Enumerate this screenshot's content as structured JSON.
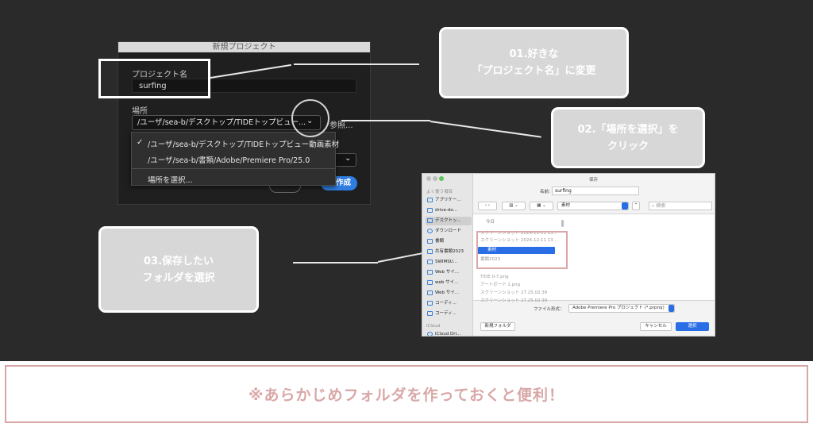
{
  "premiere_dialog": {
    "title": "新規プロジェクト",
    "project_name_label": "プロジェクト名",
    "project_name_value": "surfing",
    "location_label": "場所",
    "location_value": "/ユーザ/sea-b/デスクトップ/TIDEトップビュー...",
    "browse_label": "参照...",
    "menu_items": [
      "/ユーザ/sea-b/デスクトップ/TIDEトップビュー動画素材",
      "/ユーザ/sea-b/書類/Adobe/Premiere Pro/25.0",
      "場所を選択..."
    ],
    "checkmark": "✓",
    "create_label": "作成"
  },
  "callouts": {
    "step1": {
      "line1": "01.好きな",
      "line2": "「プロジェクト名」に変更"
    },
    "step2": {
      "line1": "02.「場所を選択」を",
      "line2": "クリック"
    },
    "step3": {
      "line1": "03.保存したい",
      "line2": "フォルダを選択"
    }
  },
  "save_dialog": {
    "title": "保存",
    "name_label": "名前:",
    "name_value": "surfing",
    "sidebar_heading": "よく使う項目",
    "sidebar_items": [
      "アプリケー...",
      "drive-do...",
      "デスクトッ...",
      "ダウンロード",
      "書類",
      "共有書類2023",
      "SWIMSU...",
      "Web サイ...",
      "web サイ...",
      "Web サイ...",
      "コーディ...",
      "コーディ..."
    ],
    "icloud_heading": "iCloud",
    "icloud_items": [
      "iCloud Dri..."
    ],
    "folder_selector": "素材",
    "search_placeholder": "検索",
    "list_heading": "今日",
    "list_items": [
      "スクリーンショット 2024-12-11 13...",
      "スクリーンショット 2024-12-11 13...",
      "素材",
      "書類2023",
      "TIDE 0-7.png",
      "アートボード 1.png",
      "スクリーンショット 27.25.02.39",
      "スクリーンショット 27.25.02.39"
    ],
    "file_format_label": "ファイル形式：",
    "file_format_value": "Adobe Premiere Pro プロジェクト (*.prproj)",
    "new_folder_label": "新規フォルダ",
    "cancel_label": "キャンセル",
    "select_label": "選択"
  },
  "banner": {
    "text": "※あらかじめフォルダを作っておくと便利！"
  },
  "colors": {
    "background": "#2a2a2a",
    "callout": "#d7d7d7",
    "accent_pink": "#d9a7a7",
    "premiere_blue": "#2f7de1",
    "mac_blue": "#2a6ee5"
  }
}
